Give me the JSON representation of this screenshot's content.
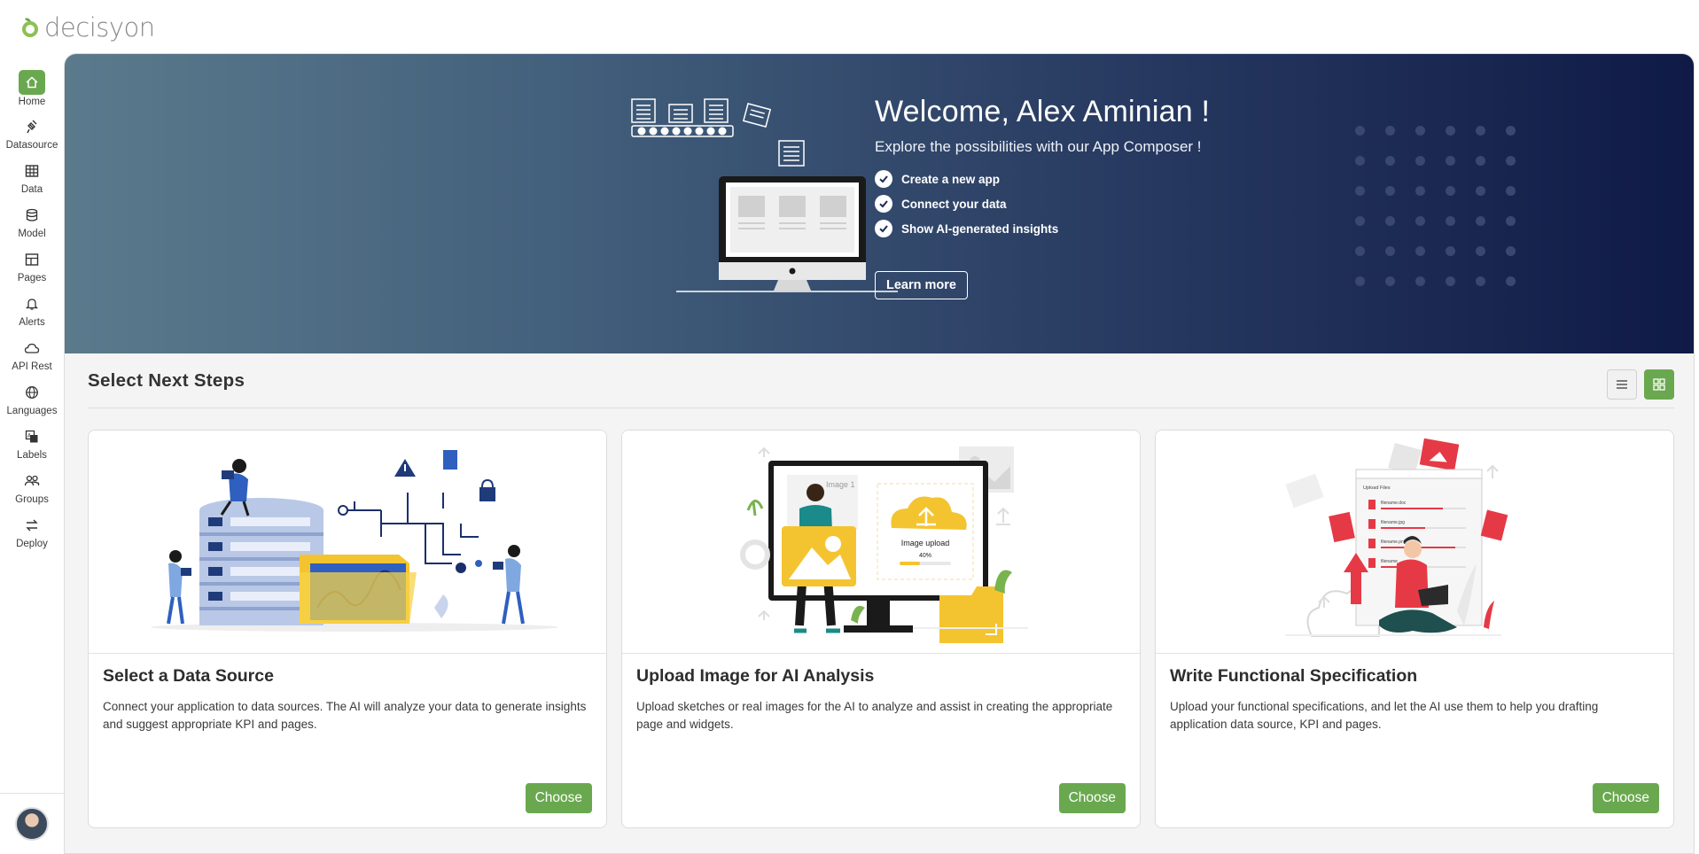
{
  "app": {
    "brand": "decisyon",
    "accent": "#6aa84f"
  },
  "sidebar": {
    "items": [
      {
        "label": "Home",
        "icon": "home-icon",
        "active": true
      },
      {
        "label": "Datasource",
        "icon": "datasource-icon"
      },
      {
        "label": "Data",
        "icon": "table-icon"
      },
      {
        "label": "Model",
        "icon": "database-icon"
      },
      {
        "label": "Pages",
        "icon": "pages-icon"
      },
      {
        "label": "Alerts",
        "icon": "bell-icon"
      },
      {
        "label": "API Rest",
        "icon": "cloud-icon"
      },
      {
        "label": "Languages",
        "icon": "globe-icon"
      },
      {
        "label": "Labels",
        "icon": "translate-icon"
      },
      {
        "label": "Groups",
        "icon": "groups-icon"
      },
      {
        "label": "Deploy",
        "icon": "deploy-icon"
      }
    ]
  },
  "hero": {
    "title": "Welcome, Alex Aminian !",
    "subtitle": "Explore the possibilities with our App Composer !",
    "checks": [
      "Create a new app",
      "Connect your data",
      "Show AI-generated insights"
    ],
    "learn_more": "Learn more"
  },
  "steps": {
    "title": "Select Next Steps",
    "view": "grid",
    "cards": [
      {
        "title": "Select a Data Source",
        "description": "Connect your application to data sources. The AI will analyze your data to generate insights and suggest appropriate KPI and pages.",
        "button": "Choose"
      },
      {
        "title": "Upload Image for AI Analysis",
        "description": "Upload sketches or real images for the AI to analyze and assist in creating the appropriate page and widgets.",
        "button": "Choose",
        "illustration": {
          "upload_label": "Image upload",
          "progress": "40%",
          "image_caption": "Image 1"
        }
      },
      {
        "title": "Write Functional Specification",
        "description": "Upload your functional specifications, and let the AI use them to help you drafting application data source, KPI and pages.",
        "button": "Choose",
        "illustration": {
          "panel_title": "Upload Files",
          "files": [
            "filename.doc",
            "filename.jpg",
            "filename.png",
            "filename"
          ]
        }
      }
    ]
  }
}
